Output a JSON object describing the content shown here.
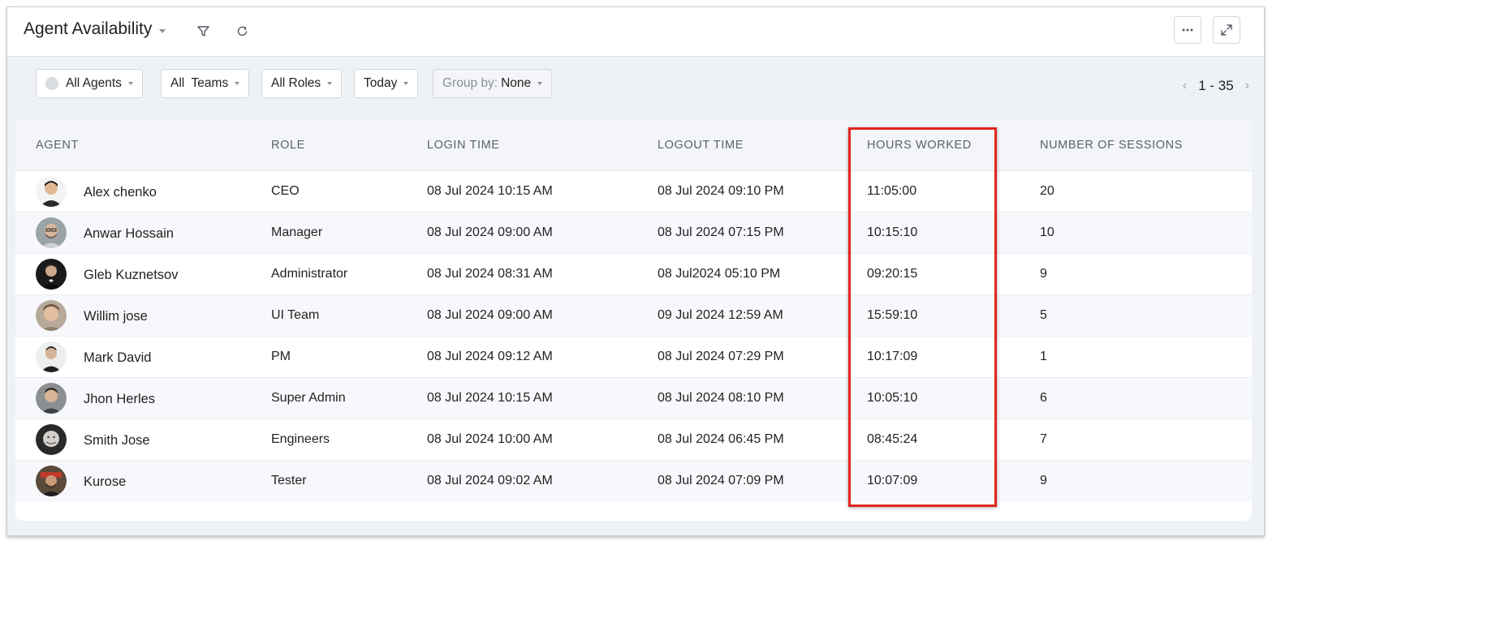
{
  "header": {
    "title": "Agent Availability",
    "icons": [
      "chevron-down-icon",
      "filter-icon",
      "refresh-icon",
      "more-icon",
      "expand-icon"
    ]
  },
  "toolbar": {
    "agents_label": "All Agents",
    "teams_label": "All  Teams",
    "roles_label": "All Roles",
    "date_label": "Today",
    "group_label": "Group by:",
    "group_value": "None",
    "pager_range": "1 - 35"
  },
  "table": {
    "columns": [
      "AGENT",
      "ROLE",
      "LOGIN TIME",
      "LOGOUT TIME",
      "HOURS WORKED",
      "NUMBER OF SESSIONS"
    ],
    "rows": [
      {
        "agent": "Alex chenko",
        "role": "CEO",
        "login": "08 Jul 2024 10:15 AM",
        "logout": "08 Jul 2024 09:10 PM",
        "hours": "11:05:00",
        "sessions": "20"
      },
      {
        "agent": "Anwar Hossain",
        "role": "Manager",
        "login": "08 Jul 2024 09:00 AM",
        "logout": "08 Jul 2024 07:15 PM",
        "hours": "10:15:10",
        "sessions": "10"
      },
      {
        "agent": "Gleb Kuznetsov",
        "role": "Administrator",
        "login": "08 Jul 2024 08:31 AM",
        "logout": "08 Jul2024 05:10 PM",
        "hours": "09:20:15",
        "sessions": "9"
      },
      {
        "agent": "Willim jose",
        "role": "UI Team",
        "login": "08 Jul 2024 09:00 AM",
        "logout": "09 Jul 2024 12:59 AM",
        "hours": "15:59:10",
        "sessions": "5"
      },
      {
        "agent": "Mark David",
        "role": "PM",
        "login": "08 Jul 2024 09:12 AM",
        "logout": "08 Jul 2024 07:29 PM",
        "hours": "10:17:09",
        "sessions": "1"
      },
      {
        "agent": "Jhon Herles",
        "role": "Super Admin",
        "login": "08 Jul 2024 10:15 AM",
        "logout": "08 Jul 2024 08:10 PM",
        "hours": "10:05:10",
        "sessions": "6"
      },
      {
        "agent": "Smith Jose",
        "role": "Engineers",
        "login": "08 Jul 2024 10:00 AM",
        "logout": "08 Jul 2024 06:45 PM",
        "hours": "08:45:24",
        "sessions": "7"
      },
      {
        "agent": "Kurose",
        "role": "Tester",
        "login": "08 Jul 2024 09:02 AM",
        "logout": "08 Jul 2024 07:09 PM",
        "hours": "10:07:09",
        "sessions": "9"
      }
    ]
  },
  "colors": {
    "accent_highlight": "#e0271f",
    "header_bg": "#f3f5f9",
    "page_bg": "#eef2f7"
  }
}
